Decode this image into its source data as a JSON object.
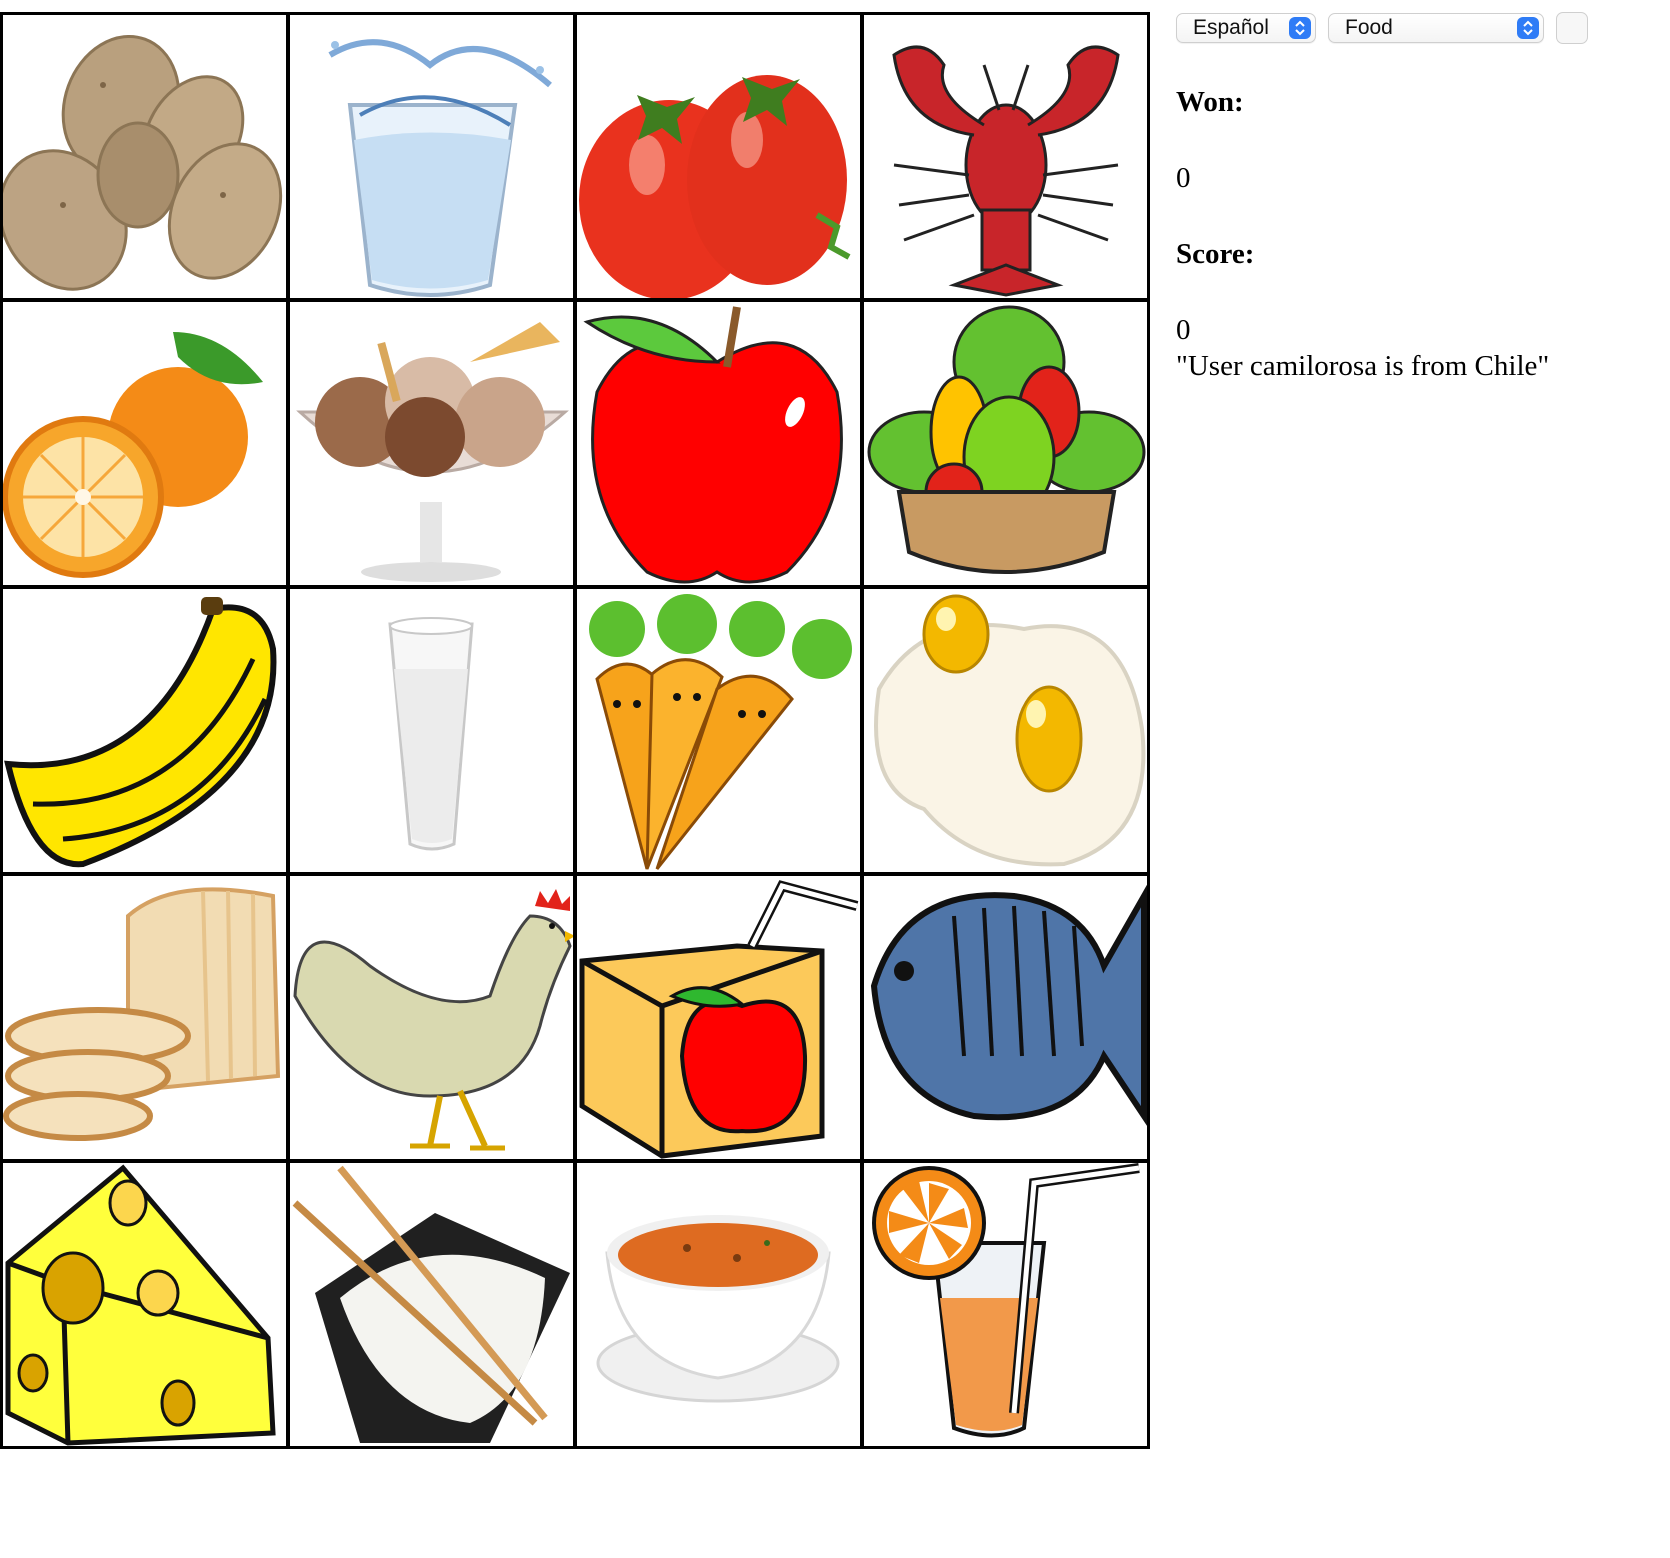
{
  "controls": {
    "language": "Español",
    "category": "Food"
  },
  "stats": {
    "won_label": "Won:",
    "won_value": "0",
    "score_label": "Score:",
    "score_value": "0",
    "message": "\"User camilorosa is from Chile\""
  },
  "tiles": [
    "potatoes",
    "water",
    "tomatoes",
    "lobster",
    "orange",
    "ice-cream",
    "apple",
    "salad",
    "banana",
    "milk",
    "carrots",
    "eggs",
    "bread",
    "chicken",
    "juice-box",
    "fish",
    "cheese",
    "rice",
    "soup",
    "orange-juice"
  ]
}
